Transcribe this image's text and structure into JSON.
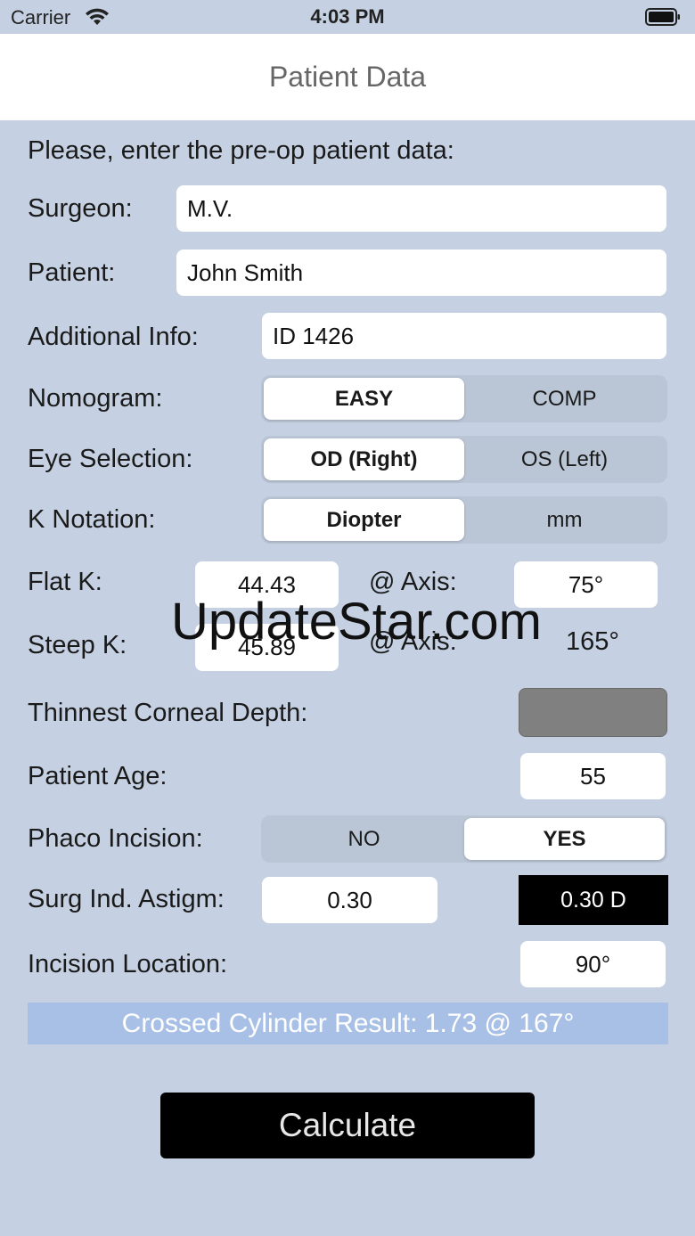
{
  "status_bar": {
    "carrier": "Carrier",
    "time": "4:03 PM"
  },
  "nav": {
    "title": "Patient Data"
  },
  "form": {
    "intro": "Please, enter the pre-op patient data:",
    "surgeon": {
      "label": "Surgeon:",
      "value": "M.V."
    },
    "patient": {
      "label": "Patient:",
      "value": "John Smith"
    },
    "additional_info": {
      "label": "Additional Info:",
      "value": "ID 1426"
    },
    "nomogram": {
      "label": "Nomogram:",
      "options": [
        "EASY",
        "COMP"
      ],
      "selected": "EASY"
    },
    "eye_selection": {
      "label": "Eye Selection:",
      "options": [
        "OD (Right)",
        "OS (Left)"
      ],
      "selected": "OD (Right)"
    },
    "k_notation": {
      "label": "K Notation:",
      "options": [
        "Diopter",
        "mm"
      ],
      "selected": "Diopter"
    },
    "flat_k": {
      "label": "Flat K:",
      "value": "44.43",
      "axis_label": "@ Axis:",
      "axis_value": "75°"
    },
    "steep_k": {
      "label": "Steep K:",
      "value": "45.89",
      "axis_label": "@ Axis:",
      "axis_value": "165°"
    },
    "thinnest_corneal_depth": {
      "label": "Thinnest Corneal Depth:",
      "value": ""
    },
    "patient_age": {
      "label": "Patient Age:",
      "value": "55"
    },
    "phaco_incision": {
      "label": "Phaco Incision:",
      "options": [
        "NO",
        "YES"
      ],
      "selected": "YES"
    },
    "surg_ind_astigm": {
      "label": "Surg Ind. Astigm:",
      "value": "0.30",
      "display": "0.30 D"
    },
    "incision_location": {
      "label": "Incision Location:",
      "value": "90°"
    }
  },
  "result": {
    "text": "Crossed Cylinder Result:  1.73  @  167°"
  },
  "calculate": {
    "label": "Calculate"
  },
  "watermark": {
    "text": "UpdateStar.com"
  },
  "colors": {
    "background": "#c5d1e2",
    "result_bar": "#a9c0e6",
    "button": "#000000"
  }
}
